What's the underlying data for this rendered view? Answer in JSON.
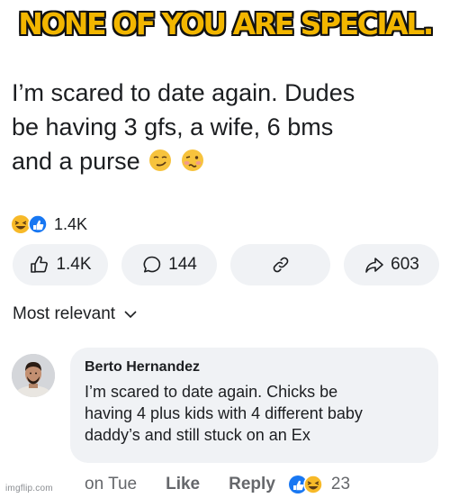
{
  "meme": {
    "caption": "NONE OF YOU ARE SPECIAL."
  },
  "post": {
    "line1": "I’m scared to date again. Dudes",
    "line2": "be having 3 gfs, a wife, 6 bms",
    "line3": "and a purse",
    "emojis": [
      "smirking-face-icon",
      "woozy-face-icon"
    ]
  },
  "reactions": {
    "icons": [
      "haha-icon",
      "like-icon"
    ],
    "total": "1.4K"
  },
  "actions": {
    "like_count": "1.4K",
    "comment_count": "144",
    "share_count": "603",
    "colors": {
      "pill_bg": "#f0f2f5",
      "icon": "#1c1e21"
    }
  },
  "sort": {
    "label": "Most relevant"
  },
  "comment": {
    "author": "Berto Hernandez",
    "line1": "I’m scared to date again. Chicks be",
    "line2": "having 4 plus kids with 4 different baby",
    "line3": "daddy’s and still stuck on an Ex",
    "time": "on Tue",
    "like_label": "Like",
    "reply_label": "Reply",
    "reaction_count": "23"
  },
  "watermark": {
    "text": "imgflip.com"
  },
  "colors": {
    "caption_fill": "#f2b600",
    "caption_stroke": "#111111",
    "like_blue": "#1877f2",
    "haha_yellow": "#f7b928"
  }
}
